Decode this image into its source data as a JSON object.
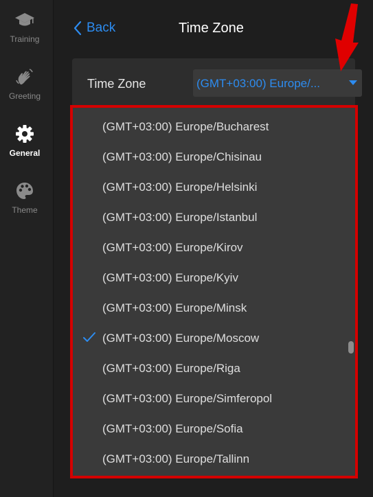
{
  "sidebar": {
    "items": [
      {
        "label": "Training",
        "icon": "graduation-cap-icon"
      },
      {
        "label": "Greeting",
        "icon": "waving-hand-icon"
      },
      {
        "label": "General",
        "icon": "gear-icon",
        "active": true
      },
      {
        "label": "Theme",
        "icon": "palette-icon"
      }
    ]
  },
  "header": {
    "back_label": "Back",
    "title": "Time Zone"
  },
  "timezone": {
    "label": "Time Zone",
    "selected_display": "(GMT+03:00) Europe/..."
  },
  "dropdown": {
    "options": [
      {
        "label": "(GMT+03:00) Europe/Bucharest",
        "checked": false
      },
      {
        "label": "(GMT+03:00) Europe/Chisinau",
        "checked": false
      },
      {
        "label": "(GMT+03:00) Europe/Helsinki",
        "checked": false
      },
      {
        "label": "(GMT+03:00) Europe/Istanbul",
        "checked": false
      },
      {
        "label": "(GMT+03:00) Europe/Kirov",
        "checked": false
      },
      {
        "label": "(GMT+03:00) Europe/Kyiv",
        "checked": false
      },
      {
        "label": "(GMT+03:00) Europe/Minsk",
        "checked": false
      },
      {
        "label": "(GMT+03:00) Europe/Moscow",
        "checked": true
      },
      {
        "label": "(GMT+03:00) Europe/Riga",
        "checked": false
      },
      {
        "label": "(GMT+03:00) Europe/Simferopol",
        "checked": false
      },
      {
        "label": "(GMT+03:00) Europe/Sofia",
        "checked": false
      },
      {
        "label": "(GMT+03:00) Europe/Tallinn",
        "checked": false
      }
    ]
  },
  "colors": {
    "accent": "#2d8cf0",
    "highlight": "#d40000",
    "background": "#1e1e1e",
    "sidebar": "#222222",
    "card": "#2d2d2d",
    "dropdown": "#3a3a3a"
  }
}
